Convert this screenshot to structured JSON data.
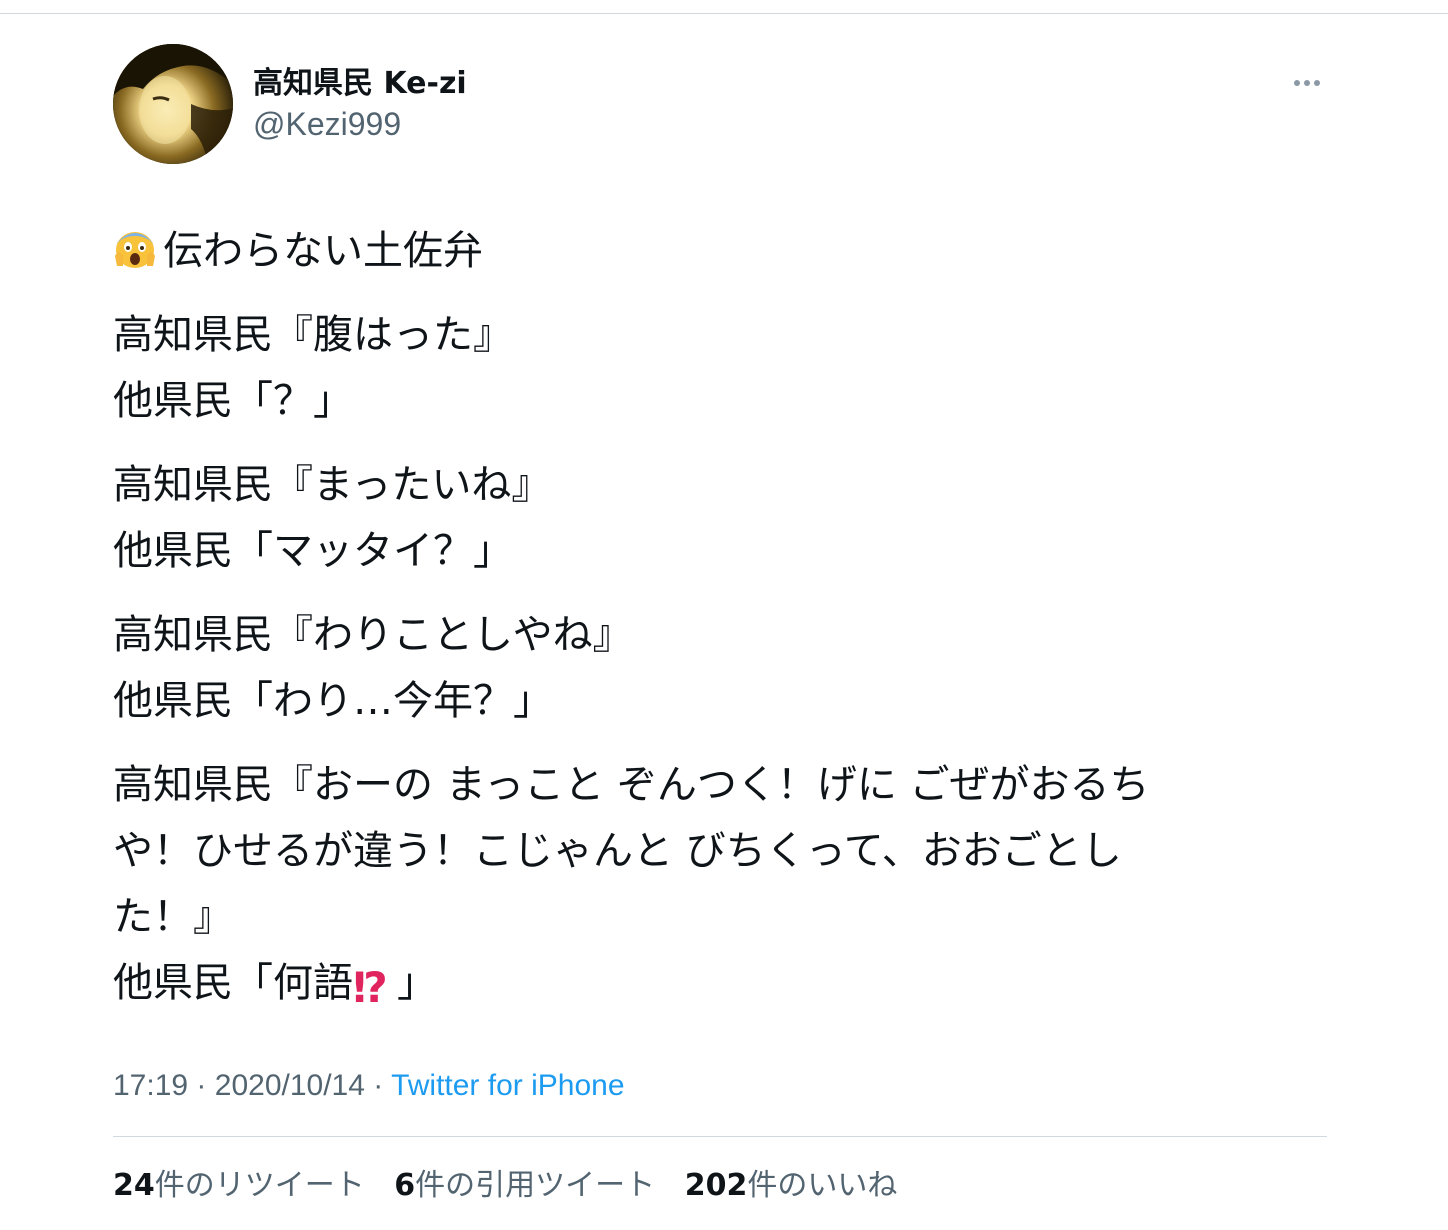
{
  "tweet": {
    "display_name": "高知県民 Ke-zi",
    "handle": "@Kezi999",
    "more_icon": "more-horizontal-icon",
    "lines": [
      "伝わらない土佐弁",
      "高知県民『腹はった』",
      "他県民「？」",
      "高知県民『まったいね』",
      "他県民「マッタイ？」",
      "高知県民『わりことしやね』",
      "他県民「わり…今年？」",
      "高知県民『おーの まっこと ぞんつく！げに ごぜがおるち",
      "や！ひせるが違う！こじゃんと びちくって、おおごとし",
      "た！』",
      "他県民「何語",
      "」"
    ],
    "emoji": {
      "title": "face-screaming-in-fear-icon",
      "last": "⁉",
      "last_icon": "exclamation-question-icon"
    },
    "time": "17:19",
    "date": "2020/10/14",
    "separator": "·",
    "source": "Twitter for iPhone",
    "stats": {
      "retweets_count": "24",
      "retweets_label": "件のリツイート",
      "quotes_count": "6",
      "quotes_label": "件の引用ツイート",
      "likes_count": "202",
      "likes_label": "件のいいね"
    },
    "colors": {
      "text": "#0f1419",
      "secondary": "#536471",
      "link": "#1d9bf0",
      "divider": "#cfd9de"
    }
  }
}
